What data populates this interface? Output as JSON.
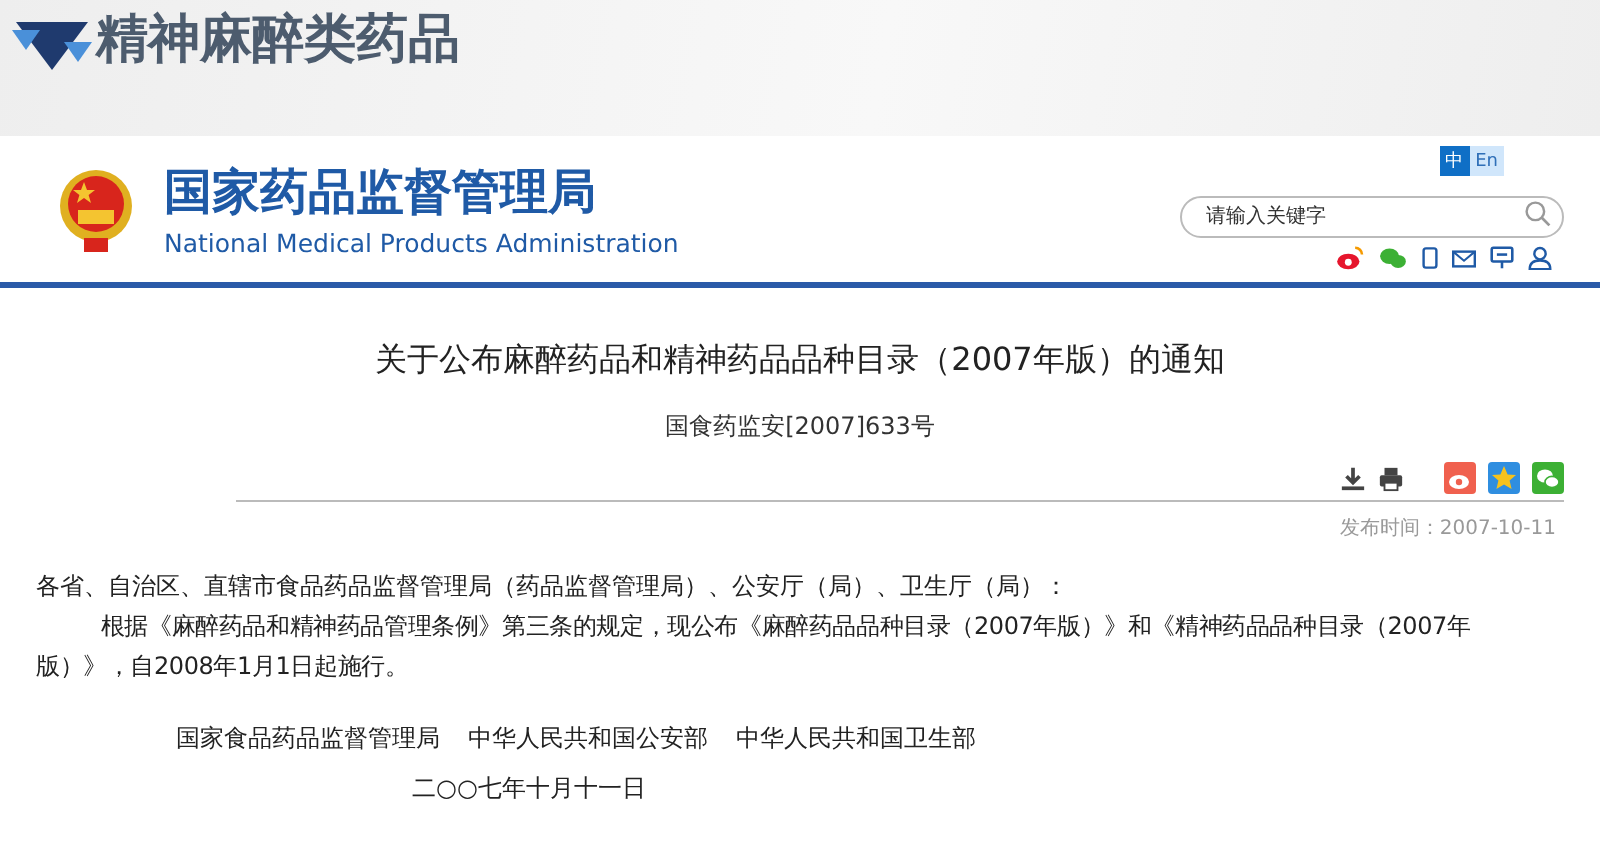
{
  "banner": {
    "title": "精神麻醉类药品"
  },
  "header": {
    "agency_name": "国家药品监督管理局",
    "agency_name_en": "National Medical Products Administration",
    "languages": [
      {
        "label": "中",
        "selected": true
      },
      {
        "label": "En",
        "selected": false
      }
    ],
    "search": {
      "placeholder": "请输入关键字"
    }
  },
  "article": {
    "title": "关于公布麻醉药品和精神药品品种目录（2007年版）的通知",
    "document_number": "国食药监安[2007]633号",
    "publish_date": "发布时间：2007-10-11",
    "salutation": "各省、自治区、直辖市食品药品监督管理局（药品监督管理局）、公安厅（局）、卫生厅（局）：",
    "body": "根据《麻醉药品和精神药品管理条例》第三条的规定，现公布《麻醉药品品种目录（2007年版）》和《精神药品品种目录（2007年版）》，自2008年1月1日起施行。",
    "signatories": [
      "国家食品药品监督管理局",
      "中华人民共和国公安部",
      "中华人民共和国卫生部"
    ],
    "date": "二○○七年十月十一日"
  }
}
